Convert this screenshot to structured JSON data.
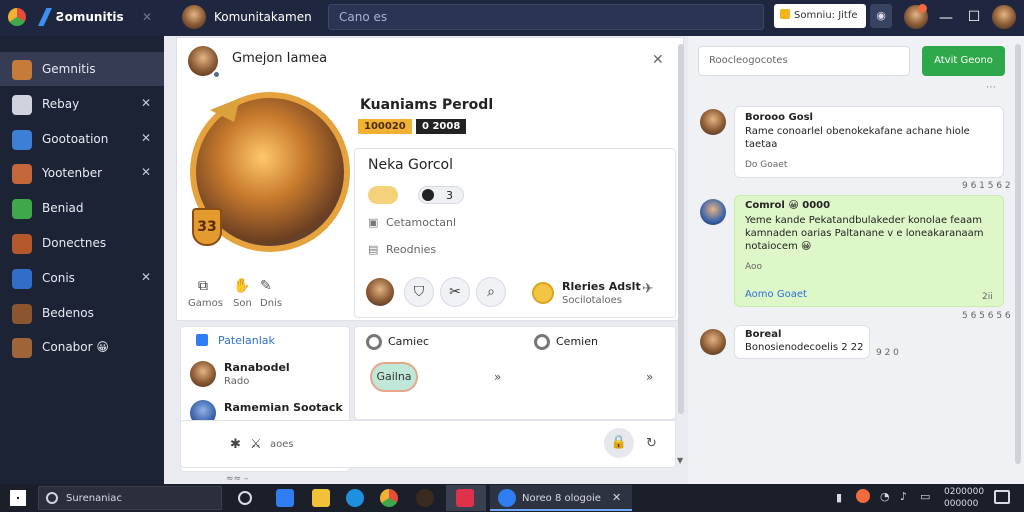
{
  "titlebar": {
    "app_name": "Ƨomunitis",
    "profile_name": "Komunitakamen",
    "search_placeholder": "Cano es",
    "pill_text": "Somniu: Jitfe",
    "round_btn": "◉"
  },
  "sidebar": {
    "items": [
      {
        "label": "Gemnitis",
        "icon": "avatar-icon",
        "color": "#c77b3a",
        "closable": false,
        "active": true
      },
      {
        "label": "Rebay",
        "icon": "gear-icon",
        "color": "#cfd3de",
        "closable": true,
        "active": false
      },
      {
        "label": "Gootoation",
        "icon": "game-icon",
        "color": "#3d7fd6",
        "closable": true,
        "active": false
      },
      {
        "label": "Yootenber",
        "icon": "character-icon",
        "color": "#c2673a",
        "closable": true,
        "active": false
      },
      {
        "label": "Beniad",
        "icon": "leaf-icon",
        "color": "#3ea84a",
        "closable": false,
        "active": false
      },
      {
        "label": "Donectnes",
        "icon": "hero-icon",
        "color": "#b4572a",
        "closable": false,
        "active": false
      },
      {
        "label": "Conis",
        "icon": "blue-game-icon",
        "color": "#2f6fc9",
        "closable": true,
        "active": false
      },
      {
        "label": "Bedenos",
        "icon": "portrait-icon",
        "color": "#8b5530",
        "closable": false,
        "active": false
      },
      {
        "label": "Conabor 😀",
        "icon": "portrait2-icon",
        "color": "#a0643a",
        "closable": false,
        "active": false
      }
    ]
  },
  "profile": {
    "header_name": "Gmejon Iamea",
    "player_name": "Kuaniams Perodl",
    "level_badge": "100020",
    "rank_badge": "0 2008",
    "emblem_number": "33",
    "left_actions": [
      "Gamos",
      "Son",
      "Dnis"
    ],
    "detail_title": "Neka Gorcol",
    "coin_count": "3",
    "detail_rows": [
      "Cetamoctanl",
      "Reodnies"
    ],
    "quest_title": "Rleries Adslt",
    "quest_sub": "Socilotaloes"
  },
  "friends": {
    "title": "Patelanlak",
    "items": [
      {
        "name": "Ranabodel",
        "sub": "Rado"
      },
      {
        "name": "Ramemian Sootack",
        "sub": ""
      }
    ]
  },
  "game_panel": {
    "col1": "Camiec",
    "col2": "Cemien",
    "pill": "Gailna",
    "footer_text": "aoes"
  },
  "chat": {
    "input_placeholder": "Roocleogocotes",
    "send_button": "Atvit Geono",
    "messages": [
      {
        "sender": "Borooo Gosl",
        "text": "Rame conoarlel obenokekafane achane hiole taetaa",
        "footer": "Do Goaet",
        "time": "9 6 1 5 6 2",
        "style": "white"
      },
      {
        "sender": "Comrol 😀 0000",
        "text": "Yeme kande Pekatandbulakeder konolae feaam kamnaden oarias Paltanane v e loneakaranaam notaiocem 😀",
        "footer": "Aomo Goaet",
        "sub_footer": "Aoo",
        "meta": "2ii",
        "time": "5 6 5 6 5 6",
        "style": "green"
      },
      {
        "sender": "Boreal",
        "text": "Bonosienodecoelis 2 22",
        "time": "9 2 0",
        "style": "white"
      }
    ]
  },
  "taskbar": {
    "search_text": "Surenaniac",
    "active_app": "Noreo 8 ologoie",
    "clock_time": "0200000",
    "clock_date": "000000"
  }
}
